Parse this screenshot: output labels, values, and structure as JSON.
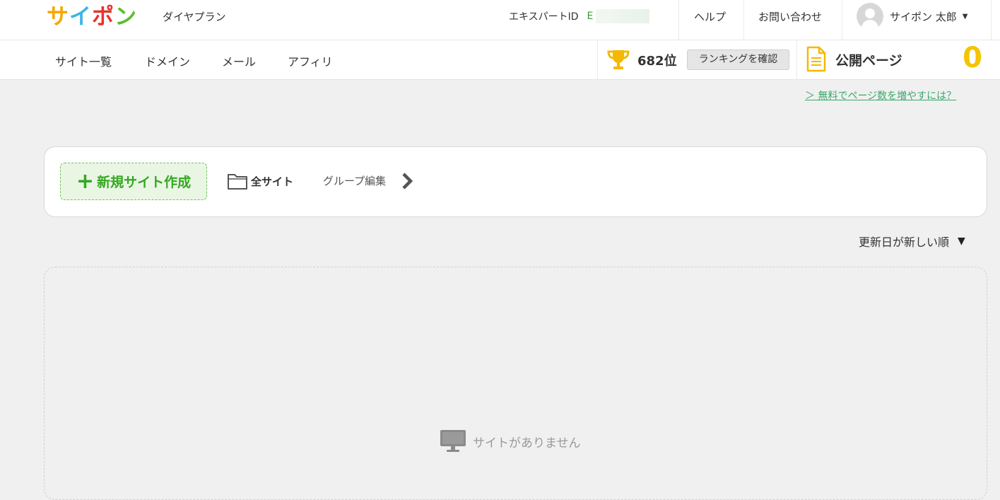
{
  "header": {
    "logo": [
      "サ",
      "イ",
      "ポ",
      "ン"
    ],
    "logo_colors": [
      "#f5a700",
      "#3cb4e6",
      "#e8322f",
      "#56c12a"
    ],
    "plan": "ダイヤプラン",
    "expert_label": "エキスパートID",
    "expert_value": "E",
    "help": "ヘルプ",
    "contact": "お問い合わせ",
    "user_name": "サイポン 太郎"
  },
  "nav": {
    "items": [
      "サイト一覧",
      "ドメイン",
      "メール",
      "アフィリ"
    ],
    "rank": "682位",
    "rank_button": "ランキングを確認",
    "public_pages_label": "公開ページ",
    "public_pages_count": "0"
  },
  "main": {
    "upsell_link": "＞ 無料でページ数を増やすには？",
    "new_site_button": "新規サイト作成",
    "all_sites": "全サイト",
    "group_edit": "グループ編集",
    "sort_label": "更新日が新しい順",
    "empty_message": "サイトがありません"
  },
  "colors": {
    "accent_green": "#33a820",
    "gold": "#f5c400",
    "link_green": "#3aa86a"
  }
}
